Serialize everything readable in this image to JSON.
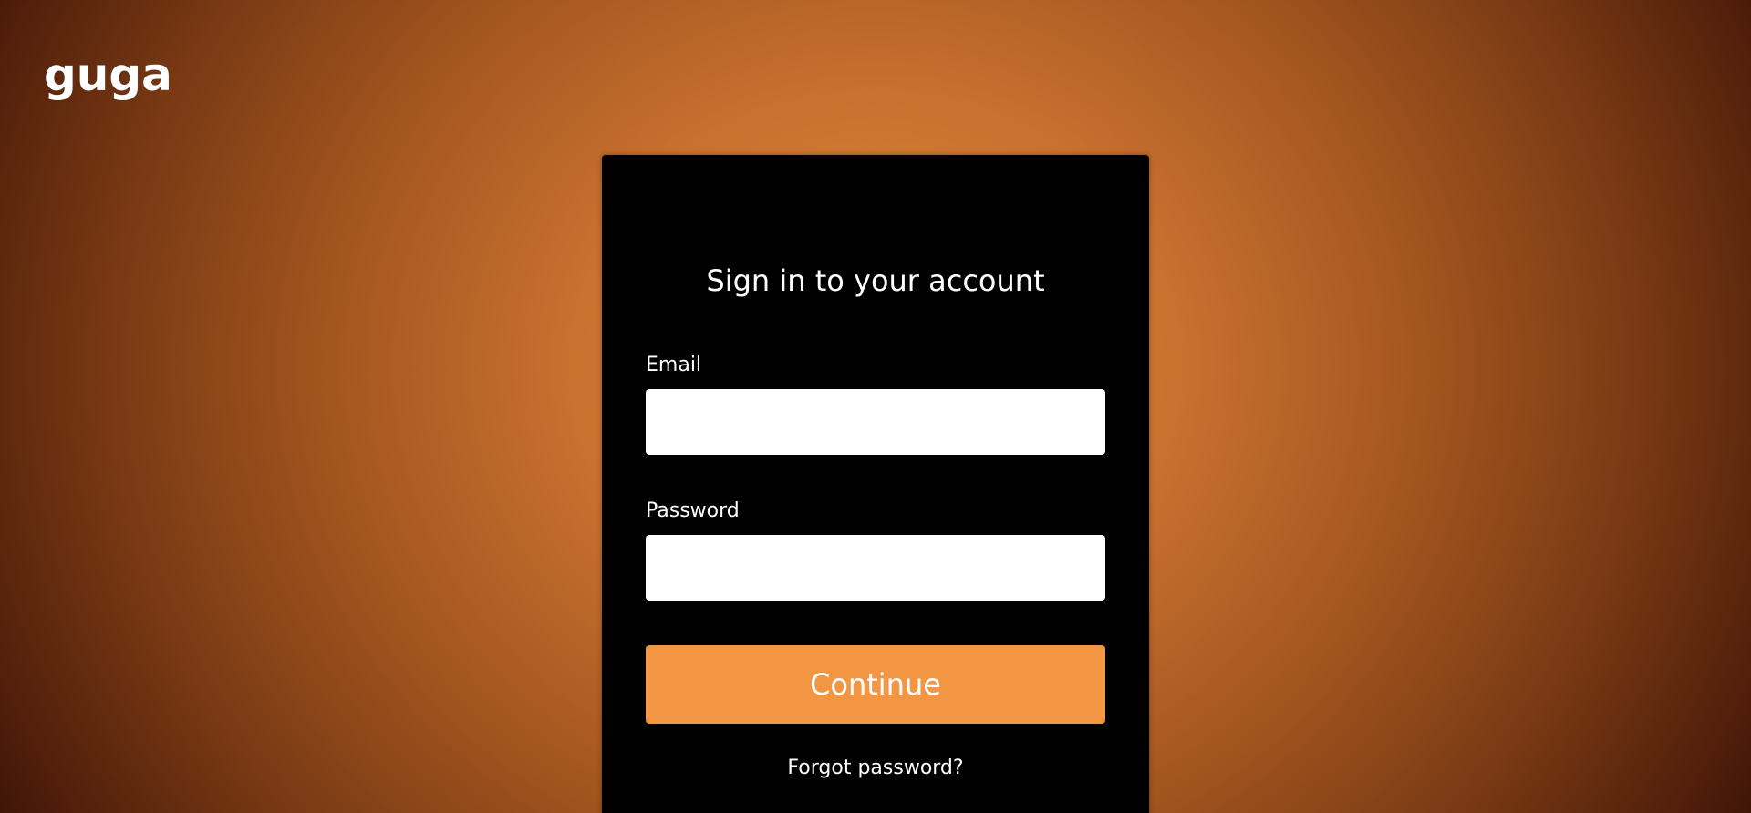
{
  "brand": {
    "logo_text": "guga"
  },
  "signin": {
    "title": "Sign in to your account",
    "email_label": "Email",
    "email_value": "",
    "email_placeholder": "",
    "password_label": "Password",
    "password_value": "",
    "password_placeholder": "",
    "continue_label": "Continue",
    "forgot_label": "Forgot password?"
  },
  "colors": {
    "accent": "#f29643",
    "card_background": "#000000",
    "background_center": "#dd8a3e",
    "background_edge": "#2a0904",
    "text": "#ffffff"
  }
}
